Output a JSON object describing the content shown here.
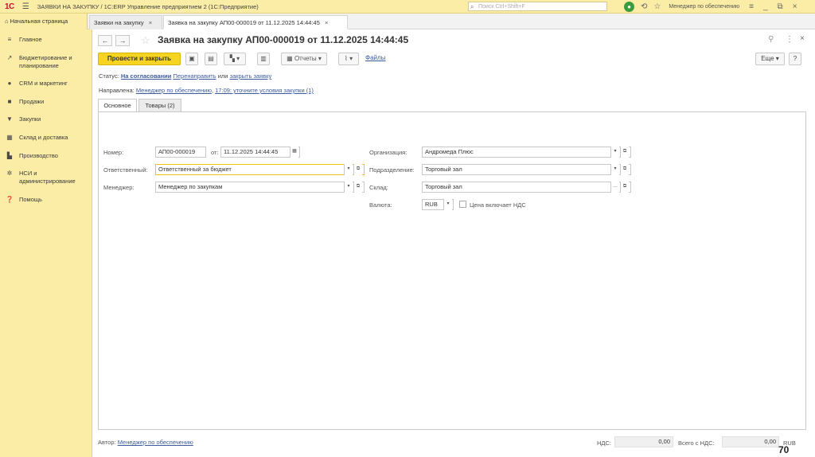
{
  "titlebar": {
    "logo": "1С",
    "title": "ЗАЯВКИ НА ЗАКУПКУ / 1С:ERP Управление предприятием 2  (1С:Предприятие)",
    "search_placeholder": "Поиск Ctrl+Shift+F",
    "user": "Менеджер по обеспечению"
  },
  "tabs": {
    "home": "Начальная страница",
    "list": "Заявки на закупку",
    "doc": "Заявка на закупку АП00-000019 от 11.12.2025 14:44:45"
  },
  "sidebar": {
    "items": [
      {
        "label": "Главное",
        "icon": "menu-icon"
      },
      {
        "label": "Бюджетирование и планирование",
        "icon": "chart-icon"
      },
      {
        "label": "CRM и маркетинг",
        "icon": "crm-icon"
      },
      {
        "label": "Продажи",
        "icon": "bag-icon"
      },
      {
        "label": "Закупки",
        "icon": "cart-icon"
      },
      {
        "label": "Склад и доставка",
        "icon": "warehouse-icon"
      },
      {
        "label": "Производство",
        "icon": "factory-icon"
      },
      {
        "label": "НСИ и администрирование",
        "icon": "gear-icon"
      },
      {
        "label": "Помощь",
        "icon": "help-icon"
      }
    ]
  },
  "form": {
    "title": "Заявка на закупку АП00-000019 от 11.12.2025 14:44:45",
    "toolbar": {
      "post_close": "Провести и закрыть",
      "reports": "Отчеты",
      "files": "Файлы",
      "more": "Еще",
      "help": "?"
    },
    "status": {
      "label": "Статус:",
      "value": "На согласовании",
      "redirect": "Перенаправить",
      "or": "или",
      "close": "закрыть заявку"
    },
    "route": {
      "label": "Направлена:",
      "to": "Менеджер по обеспечению",
      "note": "17:09: уточните условия закупки (1)"
    },
    "tabs": {
      "main": "Основное",
      "goods": "Товары (2)"
    },
    "fields": {
      "number_label": "Номер:",
      "number": "АП00-000019",
      "from_label": "от:",
      "date": "11.12.2025 14:44:45",
      "responsible_label": "Ответственный:",
      "responsible": "Ответственный за бюджет",
      "manager_label": "Менеджер:",
      "manager": "Менеджер по закупкам",
      "org_label": "Организация:",
      "org": "Андромеда Плюс",
      "dept_label": "Подразделение:",
      "dept": "Торговый зал",
      "store_label": "Склад:",
      "store": "Торговый зал",
      "currency_label": "Валюта:",
      "currency": "RUB",
      "vat_incl": "Цена включает НДС"
    },
    "footer": {
      "author_label": "Автор:",
      "author": "Менеджер по обеспечению",
      "vat_label": "НДС:",
      "vat": "0,00",
      "total_label": "Всего с НДС:",
      "total": "0,00",
      "currency": "RUB"
    }
  },
  "page_number": "70"
}
